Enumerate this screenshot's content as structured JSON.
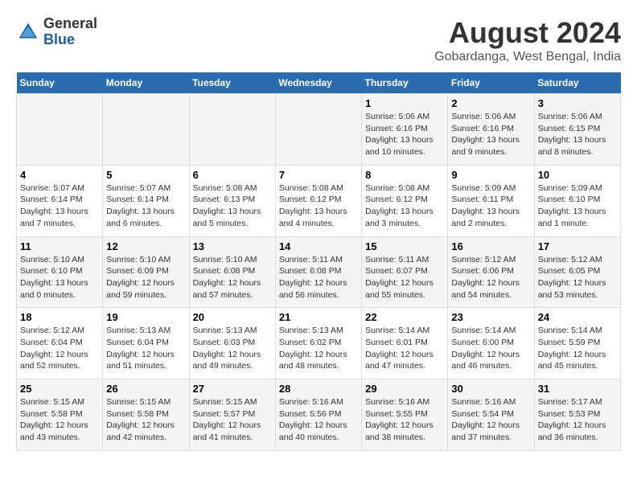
{
  "logo": {
    "general": "General",
    "blue": "Blue"
  },
  "title": "August 2024",
  "subtitle": "Gobardanga, West Bengal, India",
  "days_of_week": [
    "Sunday",
    "Monday",
    "Tuesday",
    "Wednesday",
    "Thursday",
    "Friday",
    "Saturday"
  ],
  "weeks": [
    [
      {
        "day": "",
        "content": ""
      },
      {
        "day": "",
        "content": ""
      },
      {
        "day": "",
        "content": ""
      },
      {
        "day": "",
        "content": ""
      },
      {
        "day": "1",
        "content": "Sunrise: 5:06 AM\nSunset: 6:16 PM\nDaylight: 13 hours\nand 10 minutes."
      },
      {
        "day": "2",
        "content": "Sunrise: 5:06 AM\nSunset: 6:16 PM\nDaylight: 13 hours\nand 9 minutes."
      },
      {
        "day": "3",
        "content": "Sunrise: 5:06 AM\nSunset: 6:15 PM\nDaylight: 13 hours\nand 8 minutes."
      }
    ],
    [
      {
        "day": "4",
        "content": "Sunrise: 5:07 AM\nSunset: 6:14 PM\nDaylight: 13 hours\nand 7 minutes."
      },
      {
        "day": "5",
        "content": "Sunrise: 5:07 AM\nSunset: 6:14 PM\nDaylight: 13 hours\nand 6 minutes."
      },
      {
        "day": "6",
        "content": "Sunrise: 5:08 AM\nSunset: 6:13 PM\nDaylight: 13 hours\nand 5 minutes."
      },
      {
        "day": "7",
        "content": "Sunrise: 5:08 AM\nSunset: 6:12 PM\nDaylight: 13 hours\nand 4 minutes."
      },
      {
        "day": "8",
        "content": "Sunrise: 5:08 AM\nSunset: 6:12 PM\nDaylight: 13 hours\nand 3 minutes."
      },
      {
        "day": "9",
        "content": "Sunrise: 5:09 AM\nSunset: 6:11 PM\nDaylight: 13 hours\nand 2 minutes."
      },
      {
        "day": "10",
        "content": "Sunrise: 5:09 AM\nSunset: 6:10 PM\nDaylight: 13 hours\nand 1 minute."
      }
    ],
    [
      {
        "day": "11",
        "content": "Sunrise: 5:10 AM\nSunset: 6:10 PM\nDaylight: 13 hours\nand 0 minutes."
      },
      {
        "day": "12",
        "content": "Sunrise: 5:10 AM\nSunset: 6:09 PM\nDaylight: 12 hours\nand 59 minutes."
      },
      {
        "day": "13",
        "content": "Sunrise: 5:10 AM\nSunset: 6:08 PM\nDaylight: 12 hours\nand 57 minutes."
      },
      {
        "day": "14",
        "content": "Sunrise: 5:11 AM\nSunset: 6:08 PM\nDaylight: 12 hours\nand 56 minutes."
      },
      {
        "day": "15",
        "content": "Sunrise: 5:11 AM\nSunset: 6:07 PM\nDaylight: 12 hours\nand 55 minutes."
      },
      {
        "day": "16",
        "content": "Sunrise: 5:12 AM\nSunset: 6:06 PM\nDaylight: 12 hours\nand 54 minutes."
      },
      {
        "day": "17",
        "content": "Sunrise: 5:12 AM\nSunset: 6:05 PM\nDaylight: 12 hours\nand 53 minutes."
      }
    ],
    [
      {
        "day": "18",
        "content": "Sunrise: 5:12 AM\nSunset: 6:04 PM\nDaylight: 12 hours\nand 52 minutes."
      },
      {
        "day": "19",
        "content": "Sunrise: 5:13 AM\nSunset: 6:04 PM\nDaylight: 12 hours\nand 51 minutes."
      },
      {
        "day": "20",
        "content": "Sunrise: 5:13 AM\nSunset: 6:03 PM\nDaylight: 12 hours\nand 49 minutes."
      },
      {
        "day": "21",
        "content": "Sunrise: 5:13 AM\nSunset: 6:02 PM\nDaylight: 12 hours\nand 48 minutes."
      },
      {
        "day": "22",
        "content": "Sunrise: 5:14 AM\nSunset: 6:01 PM\nDaylight: 12 hours\nand 47 minutes."
      },
      {
        "day": "23",
        "content": "Sunrise: 5:14 AM\nSunset: 6:00 PM\nDaylight: 12 hours\nand 46 minutes."
      },
      {
        "day": "24",
        "content": "Sunrise: 5:14 AM\nSunset: 5:59 PM\nDaylight: 12 hours\nand 45 minutes."
      }
    ],
    [
      {
        "day": "25",
        "content": "Sunrise: 5:15 AM\nSunset: 5:58 PM\nDaylight: 12 hours\nand 43 minutes."
      },
      {
        "day": "26",
        "content": "Sunrise: 5:15 AM\nSunset: 5:58 PM\nDaylight: 12 hours\nand 42 minutes."
      },
      {
        "day": "27",
        "content": "Sunrise: 5:15 AM\nSunset: 5:57 PM\nDaylight: 12 hours\nand 41 minutes."
      },
      {
        "day": "28",
        "content": "Sunrise: 5:16 AM\nSunset: 5:56 PM\nDaylight: 12 hours\nand 40 minutes."
      },
      {
        "day": "29",
        "content": "Sunrise: 5:16 AM\nSunset: 5:55 PM\nDaylight: 12 hours\nand 38 minutes."
      },
      {
        "day": "30",
        "content": "Sunrise: 5:16 AM\nSunset: 5:54 PM\nDaylight: 12 hours\nand 37 minutes."
      },
      {
        "day": "31",
        "content": "Sunrise: 5:17 AM\nSunset: 5:53 PM\nDaylight: 12 hours\nand 36 minutes."
      }
    ]
  ]
}
